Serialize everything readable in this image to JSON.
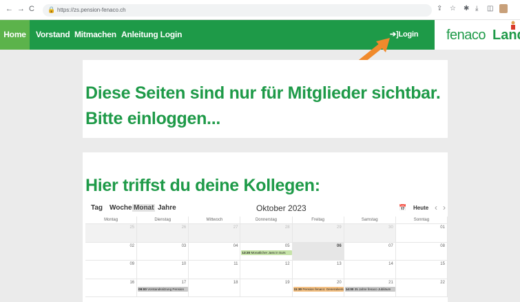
{
  "browser": {
    "back_icon": "back-arrow-icon",
    "url": "https://zs.pension-fenaco.ch"
  },
  "nav": {
    "items": [
      {
        "label": "Home"
      },
      {
        "label": "Vorstand"
      },
      {
        "label": "Mitmachen"
      },
      {
        "label": "Anleitung Login"
      }
    ],
    "login_label": "Login",
    "login_icon": "sign-in-icon"
  },
  "logo": {
    "fenaco": "fenaco",
    "landi": "Land"
  },
  "notice": {
    "line1": "Diese Seiten sind nur für Mitglieder sichtbar.",
    "line2": "Bitte einloggen..."
  },
  "calendar": {
    "headline": "Hier triffst du deine Kollegen:",
    "views": [
      "Tag",
      "Woche",
      "Monat",
      "Jahre"
    ],
    "active_view": "Monat",
    "title": "Oktober 2023",
    "today_label": "Heute",
    "weekdays": [
      "Montag",
      "Dienstag",
      "Mittwoch",
      "Donnerstag",
      "Freitag",
      "Samstag",
      "Sonntag"
    ],
    "weeks": [
      [
        {
          "d": "25",
          "o": true
        },
        {
          "d": "26",
          "o": true
        },
        {
          "d": "27",
          "o": true
        },
        {
          "d": "28",
          "o": true
        },
        {
          "d": "29",
          "o": true
        },
        {
          "d": "30",
          "o": true
        },
        {
          "d": "01"
        }
      ],
      [
        {
          "d": "02"
        },
        {
          "d": "03"
        },
        {
          "d": "04"
        },
        {
          "d": "05",
          "e": {
            "t": "13:30",
            "txt": "Monatlicher Jass in Surs",
            "c": "#c6e3a8"
          }
        },
        {
          "d": "06",
          "today": true
        },
        {
          "d": "07"
        },
        {
          "d": "08"
        }
      ],
      [
        {
          "d": "09"
        },
        {
          "d": "10"
        },
        {
          "d": "11"
        },
        {
          "d": "12"
        },
        {
          "d": "13"
        },
        {
          "d": "14"
        },
        {
          "d": "15"
        }
      ],
      [
        {
          "d": "16"
        },
        {
          "d": "17",
          "e": {
            "t": "09:00",
            "txt": "Vorstandssitzung Pension",
            "c": "#c9c9c9"
          }
        },
        {
          "d": "18"
        },
        {
          "d": "19"
        },
        {
          "d": "20",
          "e": {
            "t": "11:30",
            "txt": "Pension fenaco: Generalversammlung",
            "c": "#f3c083"
          }
        },
        {
          "d": "21",
          "e": {
            "t": "14:00",
            "txt": "35 Jahre fenaco Jubiläum",
            "c": "#c9c9c9"
          }
        },
        {
          "d": "22"
        }
      ]
    ]
  }
}
